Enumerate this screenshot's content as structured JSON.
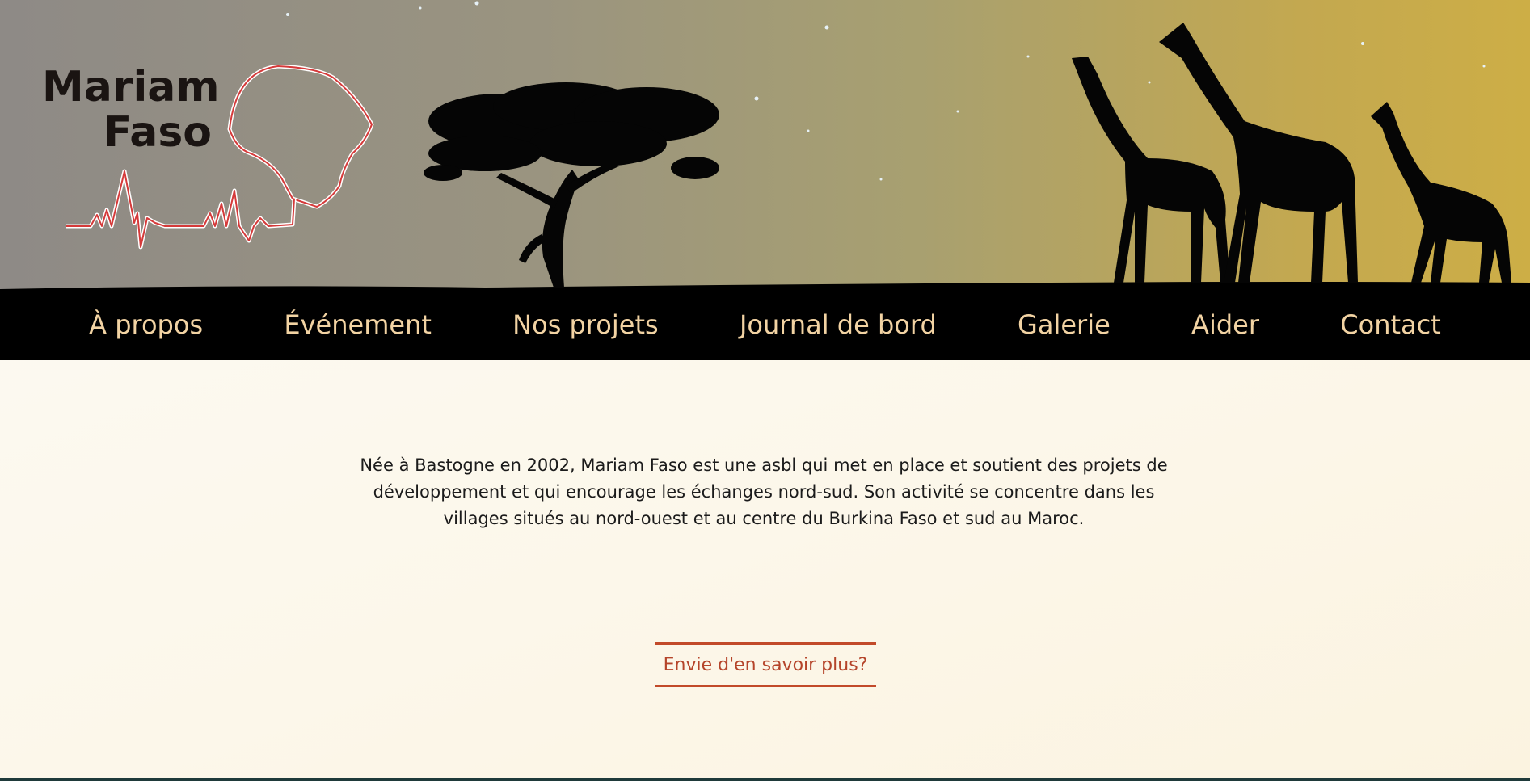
{
  "logo": {
    "line1": "Mariam",
    "line2": "Faso"
  },
  "nav": {
    "items": [
      {
        "label": "À propos"
      },
      {
        "label": "Événement"
      },
      {
        "label": "Nos projets"
      },
      {
        "label": "Journal de bord"
      },
      {
        "label": "Galerie"
      },
      {
        "label": "Aider"
      },
      {
        "label": "Contact"
      }
    ]
  },
  "main": {
    "intro": "Née à Bastogne en 2002, Mariam Faso est une asbl qui met en place et soutient des projets de développement et qui encourage les échanges nord-sud. Son activité se concentre dans les villages situés au nord-ouest et au centre du Burkina Faso et sud au Maroc.",
    "cta_label": "Envie d'en savoir plus?"
  },
  "colors": {
    "nav_text": "#f2d3a3",
    "nav_bg": "#000000",
    "accent": "#c24a2a",
    "sky_left": "#8e8a86",
    "sky_right": "#cdae46"
  },
  "icons": {
    "logo_mark": "africa-heartbeat-icon",
    "tree": "acacia-tree-silhouette",
    "giraffes": "giraffe-silhouettes"
  }
}
